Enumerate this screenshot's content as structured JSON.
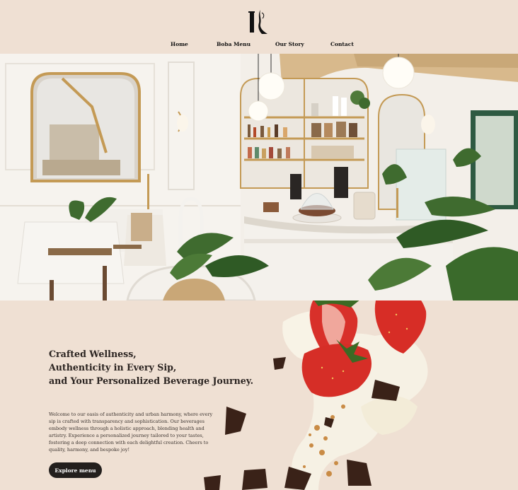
{
  "brand": {
    "logo_name": "cafe-logo"
  },
  "nav": {
    "items": [
      {
        "label": "Home"
      },
      {
        "label": "Boba Menu"
      },
      {
        "label": "Our Story"
      },
      {
        "label": "Contact"
      }
    ]
  },
  "hero": {
    "image_name": "cafe-interior-photo"
  },
  "intro": {
    "headline_lines": [
      "Crafted Wellness,",
      "Authenticity in Every Sip,",
      "and Your Personalized Beverage Journey."
    ],
    "body": "Welcome to our oasis of authenticity and urban harmony, where every sip is crafted with transparency and sophistication. Our beverages embody wellness through a holistic approach, blending health and artistry. Experience a personalized journey tailored to your tastes, fostering a deep connection with each delightful creation. Cheers to quality, harmony, and bespoke joy!",
    "cta_label": "Explore menu"
  },
  "colors": {
    "background": "#efe0d3",
    "button": "#231f1d",
    "button_text": "#ffffff",
    "text": "#2a2320"
  }
}
